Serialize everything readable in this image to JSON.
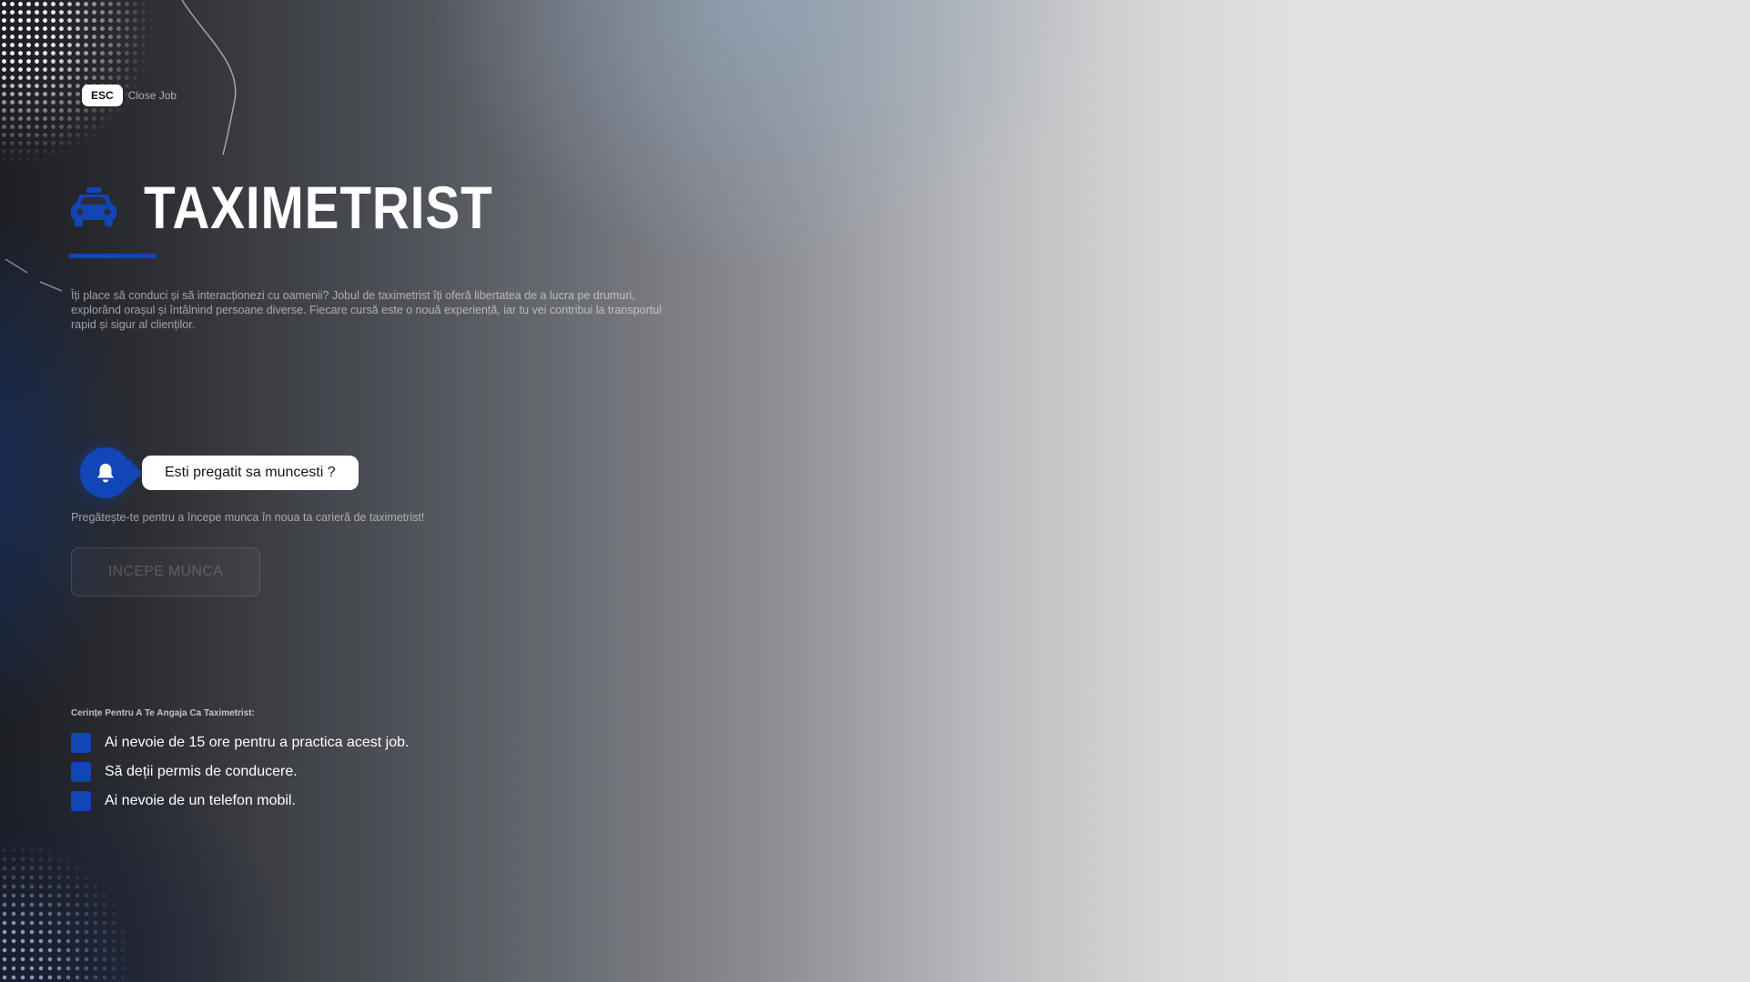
{
  "header": {
    "esc_key": "ESC",
    "close_label": "Close Job"
  },
  "job": {
    "icon": "taxi-icon",
    "title": "TAXIMETRIST",
    "accent_color": "#1245b5",
    "description": "Îți place să conduci și să interacționezi cu oamenii? Jobul de taximetrist îți oferă libertatea de a lucra pe drumuri, explorând orașul și întâlnind persoane diverse. Fiecare cursă este o nouă experiență, iar tu vei contribui la transportul rapid și sigur al clienților."
  },
  "notification": {
    "icon": "bell-icon",
    "question": "Esti pregatit sa muncesti ?",
    "subtext": "Pregătește-te pentru a începe munca în noua ta carieră de taximetrist!"
  },
  "actions": {
    "start_label": "INCEPE MUNCA"
  },
  "requirements": {
    "heading": "Cerințe Pentru A Te Angaja Ca Taximetrist:",
    "items": [
      "Ai nevoie de 15 ore pentru a practica acest job.",
      "Să deții permis de conducere.",
      "Ai nevoie de un telefon mobil."
    ]
  }
}
